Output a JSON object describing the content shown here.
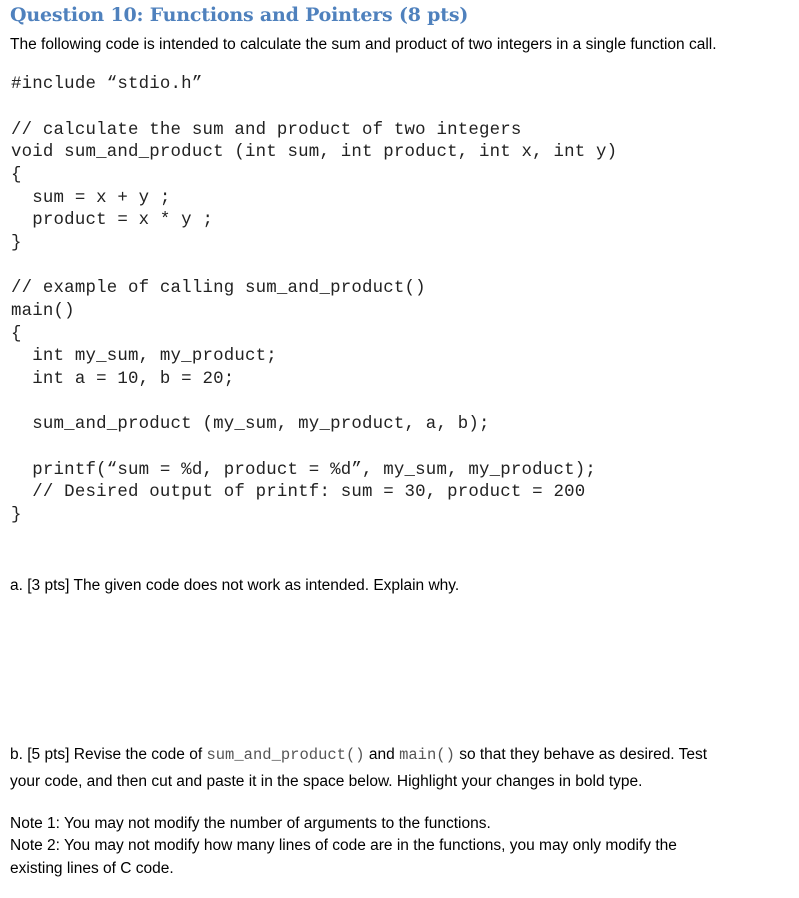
{
  "question": {
    "title": "Question 10: Functions and Pointers (8 pts)",
    "intro": "The following code is intended to calculate the sum and product of two integers in a single function call."
  },
  "code": {
    "lines": [
      "#include “stdio.h”",
      "",
      "// calculate the sum and product of two integers",
      "void sum_and_product (int sum, int product, int x, int y)",
      "{",
      "  sum = x + y ;",
      "  product = x * y ;",
      "}",
      "",
      "// example of calling sum_and_product()",
      "main()",
      "{",
      "  int my_sum, my_product;",
      "  int a = 10, b = 20;",
      "",
      "  sum_and_product (my_sum, my_product, a, b);",
      "",
      "  printf(“sum = %d, product = %d”, my_sum, my_product);",
      "  // Desired output of printf: sum = 30, product = 200",
      "}"
    ]
  },
  "part_a": {
    "text": "a. [3 pts] The given code does not work as intended. Explain why."
  },
  "part_b": {
    "prefix": "b. [5 pts] Revise the code of ",
    "code1": "sum_and_product()",
    "mid": " and ",
    "code2": "main()",
    "suffix": " so that they behave as desired. Test",
    "line2": "your code, and then cut and paste it in the space below. Highlight your changes in bold type."
  },
  "notes": {
    "note1": "Note 1: You may not modify the number of arguments to the functions.",
    "note2_line1": "Note 2: You may not modify how many lines of code are in the functions, you may only modify the",
    "note2_line2": "existing lines of C code."
  }
}
